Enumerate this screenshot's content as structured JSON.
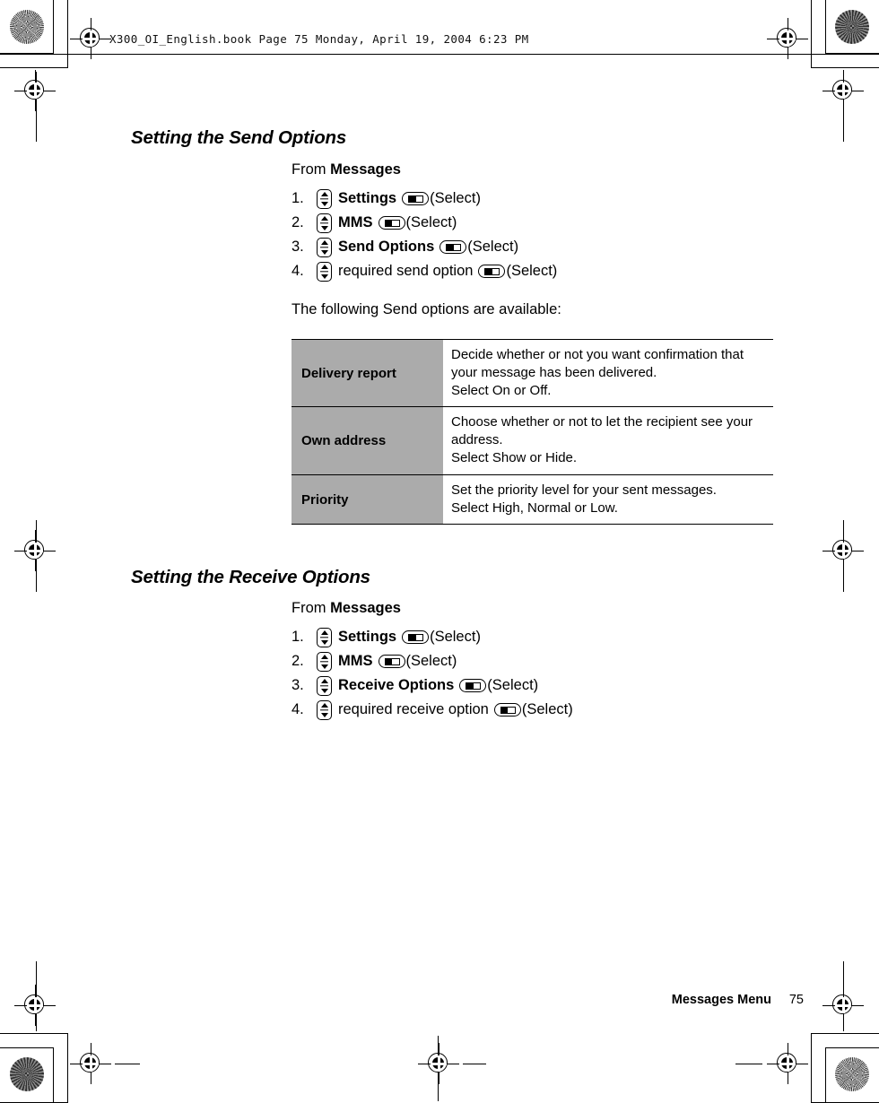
{
  "print_header": {
    "text": "X300_OI_English.book  Page 75  Monday, April 19, 2004  6:23 PM"
  },
  "sections": [
    {
      "title": "Setting the Send Options",
      "from_prefix": "From ",
      "from_target": "Messages",
      "steps": [
        {
          "num": "1.",
          "label": "Settings",
          "bold": true,
          "tail": "(Select)"
        },
        {
          "num": "2.",
          "label": "MMS",
          "bold": true,
          "tail": "(Select)"
        },
        {
          "num": "3.",
          "label": "Send Options",
          "bold": true,
          "tail": "(Select)"
        },
        {
          "num": "4.",
          "label": "required send option",
          "bold": false,
          "tail": "(Select)"
        }
      ],
      "lead_text": "The following Send options are available:",
      "table": {
        "rows": [
          {
            "key": "Delivery report",
            "lines": [
              "Decide whether or not you want confirmation that your message has been delivered.",
              "Select On or Off."
            ]
          },
          {
            "key": "Own address",
            "lines": [
              "Choose whether or not to let the recipient see your address.",
              "Select Show or Hide."
            ]
          },
          {
            "key": "Priority",
            "lines": [
              "Set the priority level for your sent messages.",
              "Select High, Normal or Low."
            ]
          }
        ]
      }
    },
    {
      "title": "Setting the Receive Options",
      "from_prefix": "From ",
      "from_target": "Messages",
      "steps": [
        {
          "num": "1.",
          "label": "Settings",
          "bold": true,
          "tail": "(Select)"
        },
        {
          "num": "2.",
          "label": "MMS",
          "bold": true,
          "tail": "(Select)"
        },
        {
          "num": "3.",
          "label": "Receive Options",
          "bold": true,
          "tail": "(Select)"
        },
        {
          "num": "4.",
          "label": "required receive option",
          "bold": false,
          "tail": "(Select)"
        }
      ]
    }
  ],
  "footer": {
    "chapter": "Messages Menu",
    "page_number": "75"
  },
  "icons": {
    "scroll_key": "scroll-up-down-key-icon",
    "soft_key": "left-soft-key-icon"
  },
  "colors": {
    "table_header_gray": "#ababab",
    "rule_black": "#000000",
    "page_white": "#ffffff"
  }
}
